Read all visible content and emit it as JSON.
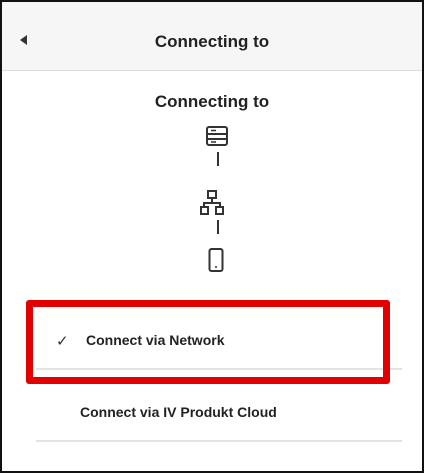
{
  "header": {
    "title": "Connecting to",
    "back_icon": "back-triangle-icon"
  },
  "main": {
    "title": "Connecting to",
    "diagram_icons": [
      "server-icon",
      "network-icon",
      "smartphone-icon"
    ],
    "options": [
      {
        "label": "Connect via Network",
        "selected": true
      },
      {
        "label": "Connect via IV Produkt Cloud",
        "selected": false
      }
    ]
  },
  "colors": {
    "highlight": "#e30000",
    "header_bg": "#f6f6f6"
  }
}
